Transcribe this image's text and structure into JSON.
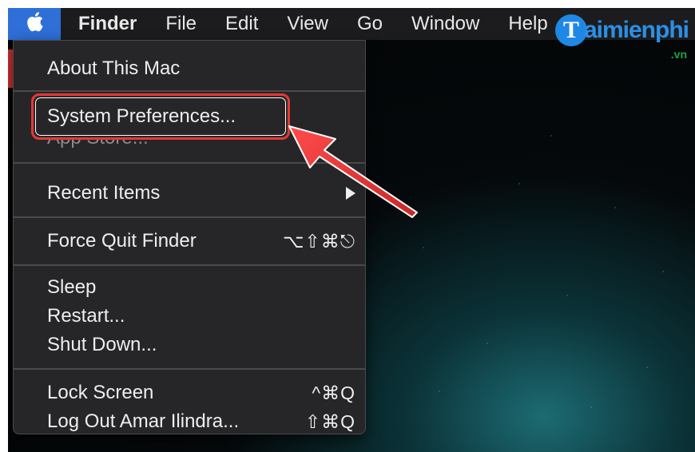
{
  "menubar": {
    "apple_icon": "apple-logo-icon",
    "items": [
      "Finder",
      "File",
      "Edit",
      "View",
      "Go",
      "Window",
      "Help"
    ]
  },
  "menu": {
    "about": "About This Mac",
    "system_preferences": "System Preferences...",
    "app_store": "App Store...",
    "recent_items": "Recent Items",
    "force_quit": "Force Quit Finder",
    "force_quit_shortcut": "⌥⇧⌘⎋",
    "sleep": "Sleep",
    "restart": "Restart...",
    "shut_down": "Shut Down...",
    "lock_screen": "Lock Screen",
    "lock_screen_shortcut": "^⌘Q",
    "log_out": "Log Out Amar Ilindra...",
    "log_out_shortcut": "⇧⌘Q"
  },
  "watermark": {
    "letter": "T",
    "name": "aimienphi",
    "tld": ".vn"
  },
  "colors": {
    "highlight": "#e53935",
    "apple_button": "#2f6fd8",
    "menu_bg": "#262628"
  }
}
